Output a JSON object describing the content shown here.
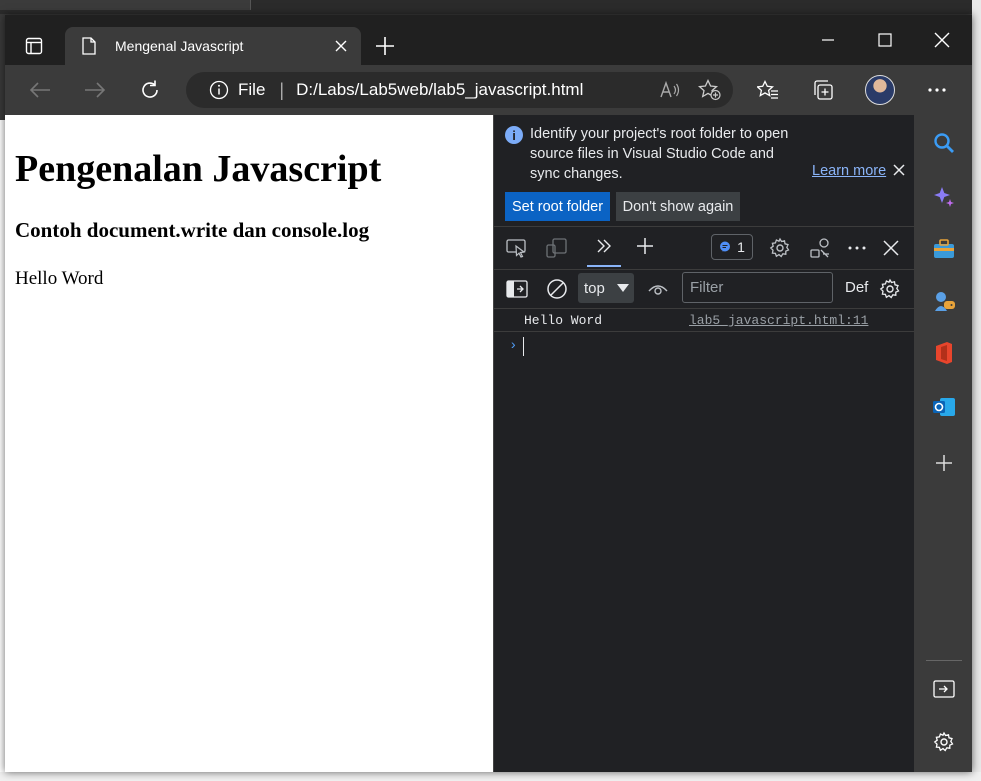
{
  "browser": {
    "tab_title": "Mengenal Javascript",
    "address": {
      "scheme_label": "File",
      "separator": "|",
      "url": "D:/Labs/Lab5web/lab5_javascript.html"
    }
  },
  "page": {
    "heading": "Pengenalan Javascript",
    "subheading": "Contoh document.write dan console.log",
    "body_text": "Hello Word"
  },
  "devtools": {
    "infobar": {
      "message": "Identify your project's root folder to open source files in Visual Studio Code and sync changes.",
      "learn_more": "Learn more",
      "primary_button": "Set root folder",
      "secondary_button": "Don't show again"
    },
    "issues_count": "1",
    "context": "top",
    "filter_placeholder": "Filter",
    "levels_label": "Def",
    "console": {
      "message": "Hello Word",
      "source": "lab5_javascript.html:11"
    }
  },
  "colors": {
    "accent": "#0b63c4",
    "link": "#8ab4f8"
  }
}
